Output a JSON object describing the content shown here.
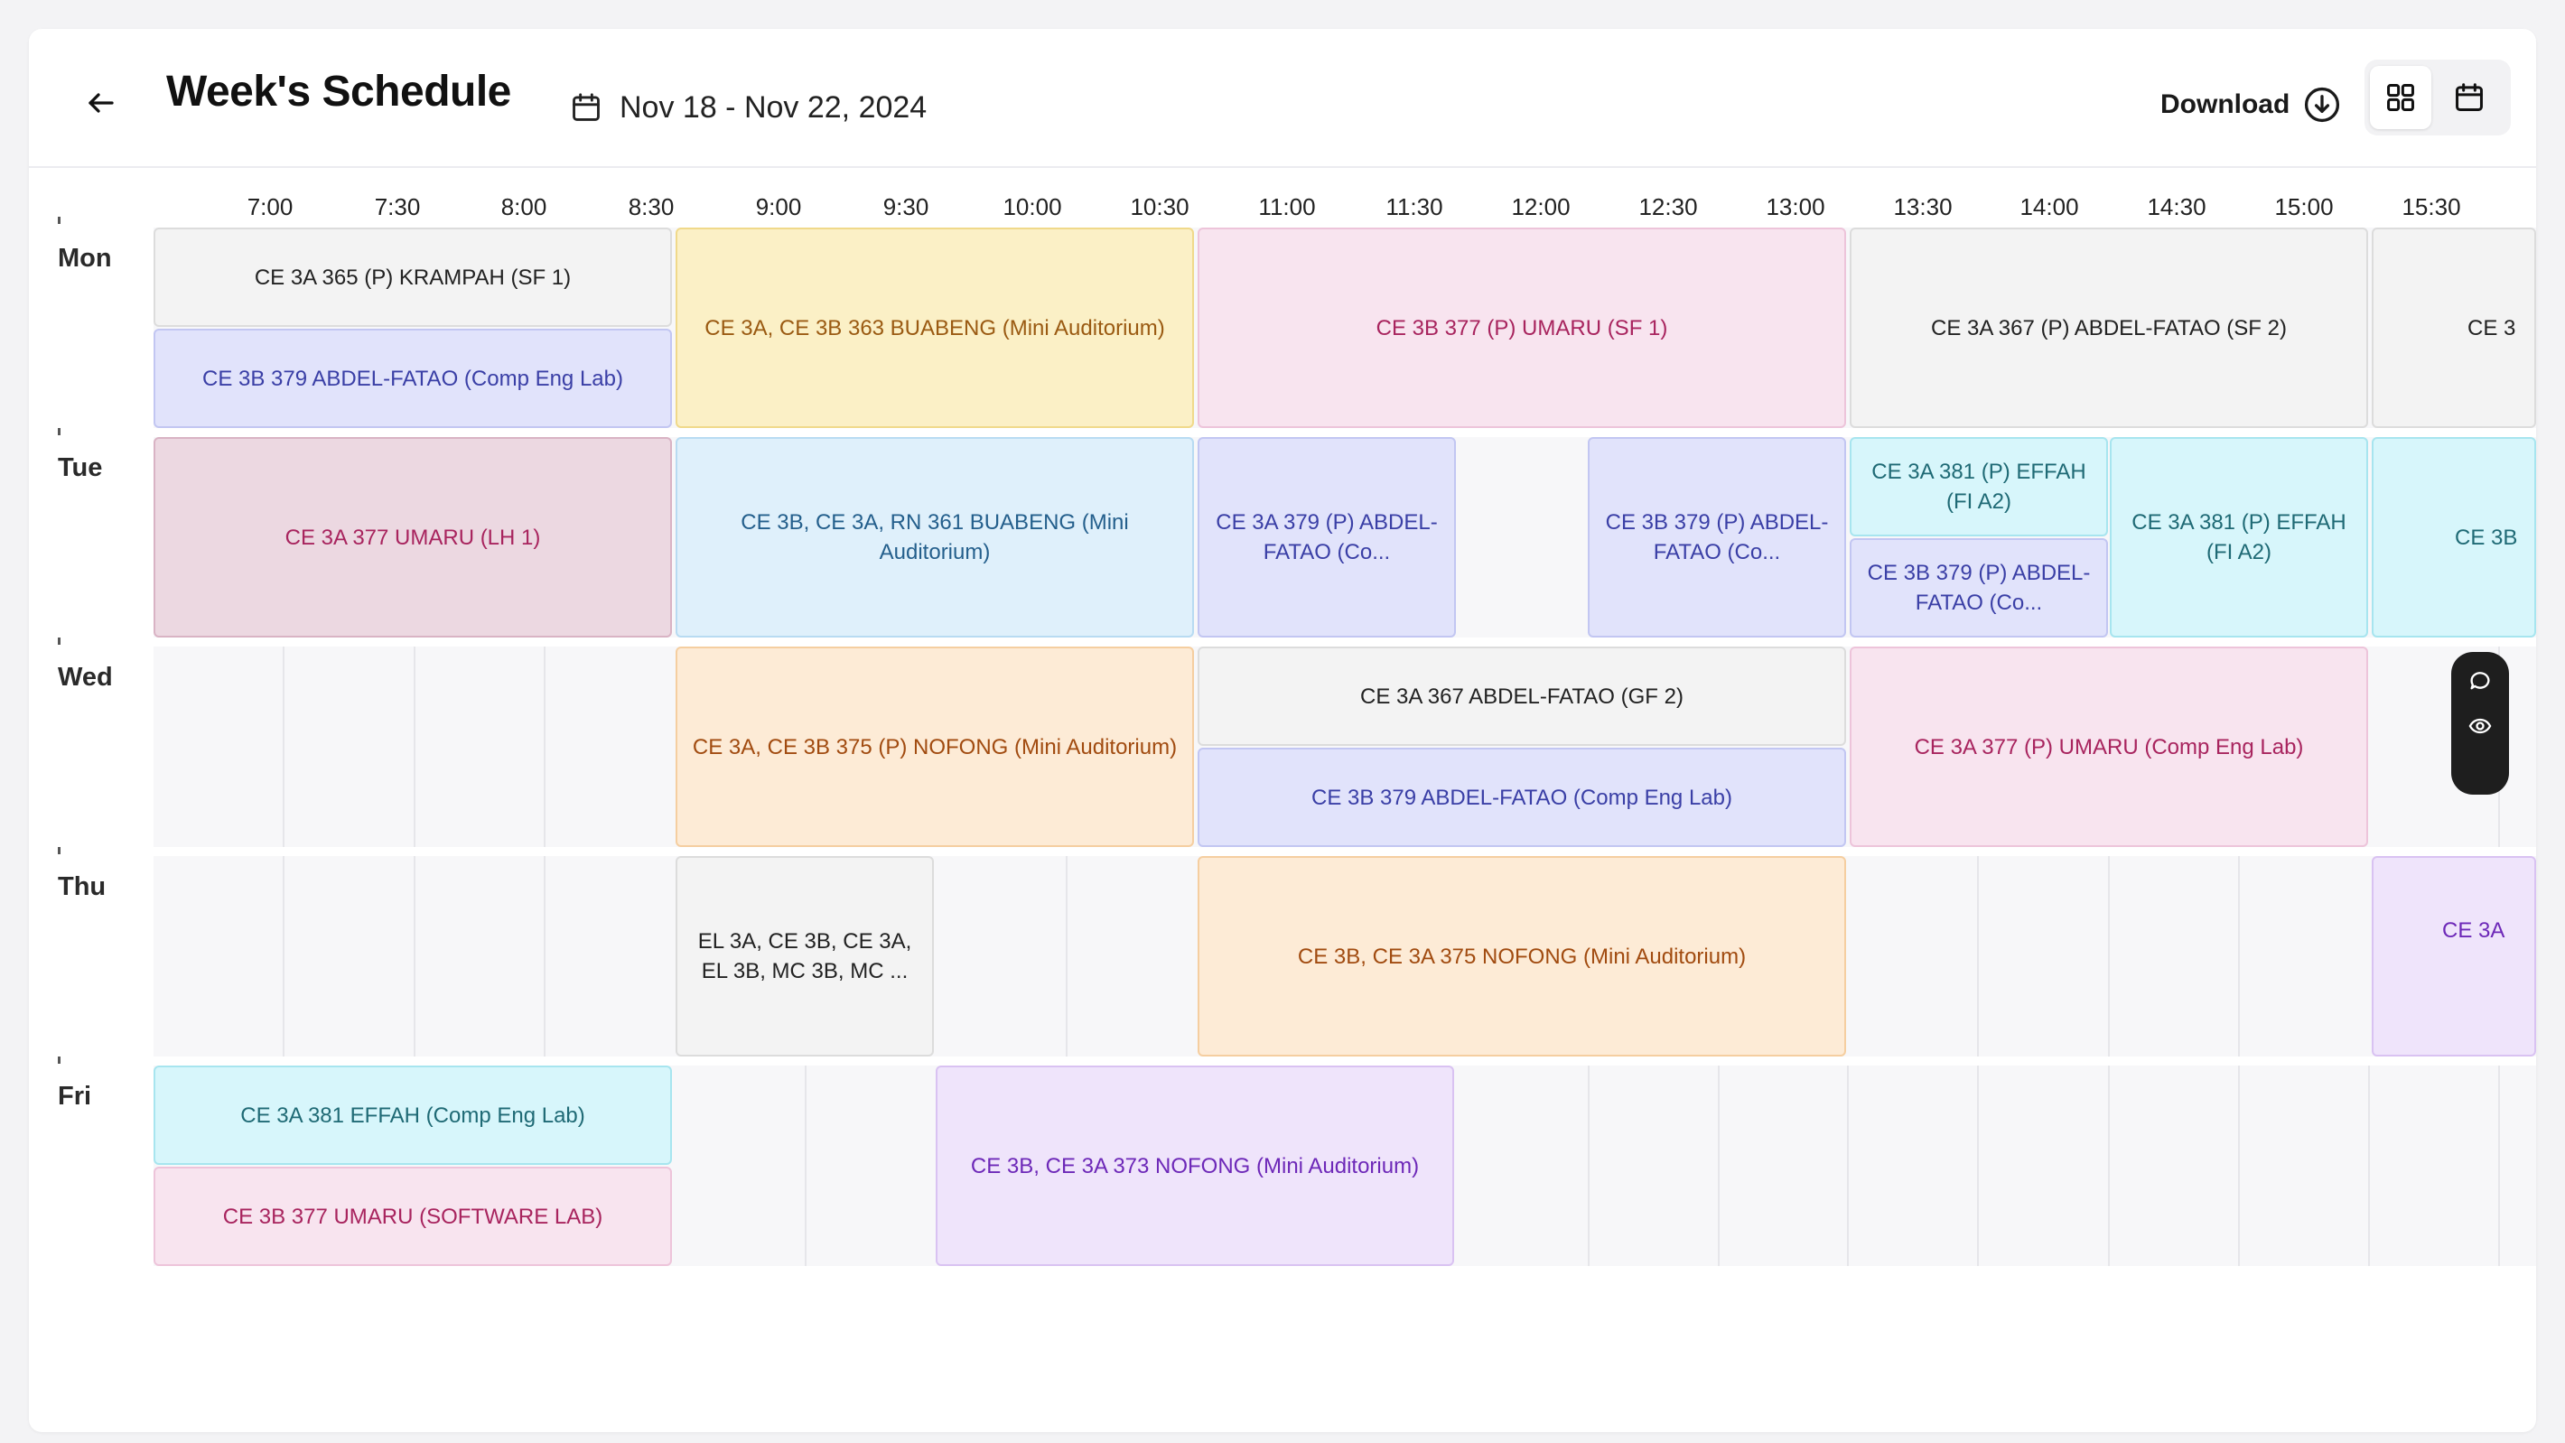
{
  "header": {
    "title": "Week's Schedule",
    "date_range": "Nov 18 - Nov 22, 2024",
    "download_label": "Download",
    "icons": {
      "back": "arrow-left-icon",
      "calendar": "calendar-icon",
      "download": "download-circle-icon",
      "grid_view": "grid-view-icon",
      "calendar_view": "calendar-view-icon"
    }
  },
  "time_axis": [
    "7:00",
    "7:30",
    "8:00",
    "8:30",
    "9:00",
    "9:30",
    "10:00",
    "10:30",
    "11:00",
    "11:30",
    "12:00",
    "12:30",
    "13:00",
    "13:30",
    "14:00",
    "14:30",
    "15:00",
    "15:30"
  ],
  "days": [
    "Mon",
    "Tue",
    "Wed",
    "Thu",
    "Fri"
  ],
  "colors": {
    "gray": "#f3f3f3",
    "lavender": "#e1e3fb",
    "yellow": "#fbf0c6",
    "pink": "#f8e4ef",
    "rose": "#ecd8e1",
    "blue": "#dff0fb",
    "cyan": "#d7f6fb",
    "orange": "#fdebd6",
    "purple": "#efe4fb"
  },
  "events": {
    "mon": [
      "CE 3A 365 (P) KRAMPAH (SF 1)",
      "CE 3B 379 ABDEL-FATAO (Comp Eng Lab)",
      "CE 3A, CE 3B 363 BUABENG (Mini Auditorium)",
      "CE 3B 377 (P) UMARU (SF 1)",
      "CE 3A 367 (P) ABDEL-FATAO (SF 2)",
      "CE 3"
    ],
    "tue": [
      "CE 3A 377 UMARU (LH 1)",
      "CE 3B, CE 3A, RN 361 BUABENG (Mini Auditorium)",
      "CE 3A 379 (P) ABDEL-FATAO (Co...",
      "CE 3B 379 (P) ABDEL-FATAO (Co...",
      "CE 3A 381 (P) EFFAH (FI A2)",
      "CE 3B 379 (P) ABDEL-FATAO (Co...",
      "CE 3A 381 (P) EFFAH (FI A2)",
      "CE 3B"
    ],
    "wed": [
      "CE 3A, CE 3B 375 (P) NOFONG (Mini Auditorium)",
      "CE 3A 367 ABDEL-FATAO (GF 2)",
      "CE 3B 379 ABDEL-FATAO (Comp Eng Lab)",
      "CE 3A 377 (P) UMARU (Comp Eng Lab)"
    ],
    "thu": [
      "EL 3A, CE 3B, CE 3A, EL 3B, MC 3B, MC ...",
      "CE 3B, CE 3A 375 NOFONG (Mini Auditorium)",
      "CE 3A"
    ],
    "fri": [
      "CE 3A 381 EFFAH (Comp Eng Lab)",
      "CE 3B 377 UMARU (SOFTWARE LAB)",
      "CE 3B, CE 3A 373 NOFONG (Mini Auditorium)"
    ]
  },
  "floating_toolbar": {
    "icons": [
      "comment-icon",
      "eye-icon"
    ]
  }
}
